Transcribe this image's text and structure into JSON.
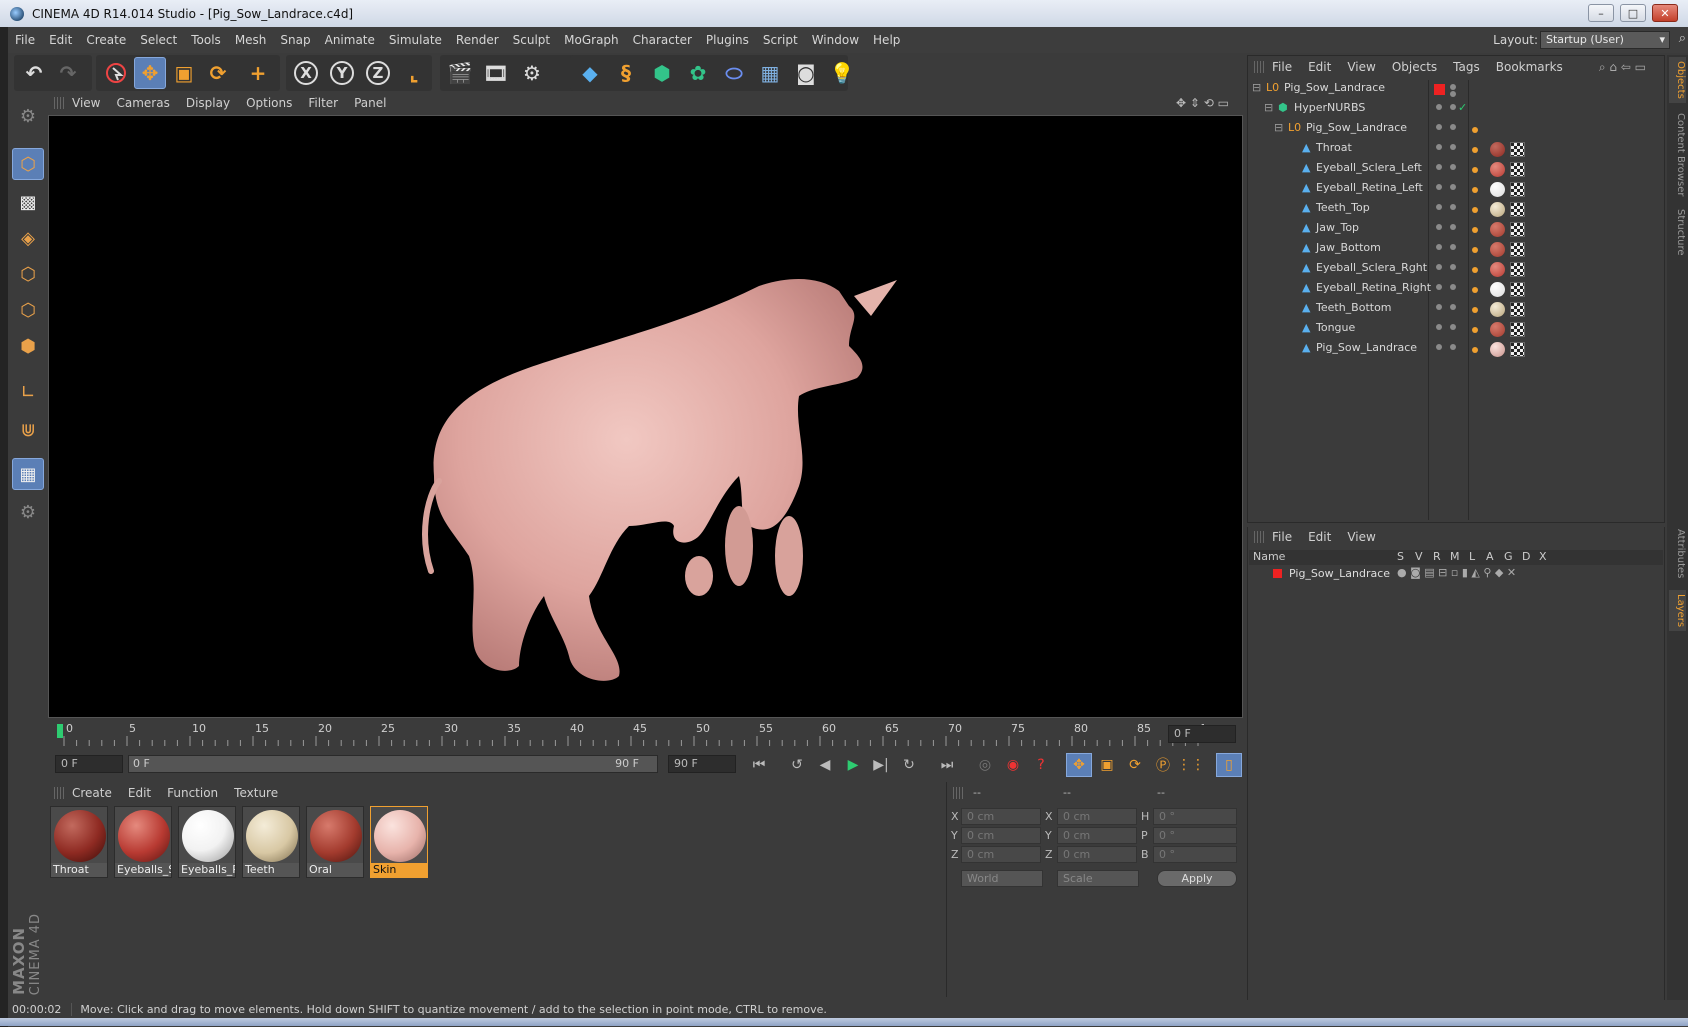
{
  "window": {
    "title": "CINEMA 4D R14.014 Studio - [Pig_Sow_Landrace.c4d]",
    "min": "–",
    "max": "□",
    "close": "✕"
  },
  "menubar": {
    "items": [
      "File",
      "Edit",
      "Create",
      "Select",
      "Tools",
      "Mesh",
      "Snap",
      "Animate",
      "Simulate",
      "Render",
      "Sculpt",
      "MoGraph",
      "Character",
      "Plugins",
      "Script",
      "Window",
      "Help"
    ],
    "layout_label": "Layout:",
    "layout_value": "Startup (User)"
  },
  "viewport": {
    "menu": [
      "View",
      "Cameras",
      "Display",
      "Options",
      "Filter",
      "Panel"
    ]
  },
  "timeline": {
    "ticks": [
      "0",
      "5",
      "10",
      "15",
      "20",
      "25",
      "30",
      "35",
      "40",
      "45",
      "50",
      "55",
      "60",
      "65",
      "70",
      "75",
      "80",
      "85",
      "90"
    ],
    "current_frame": "0 F",
    "start": "0 F",
    "range_start": "0 F",
    "range_end": "90 F",
    "end": "90 F"
  },
  "materials": {
    "menu": [
      "Create",
      "Edit",
      "Function",
      "Texture"
    ],
    "items": [
      {
        "name": "Throat",
        "color": "#8e2a22"
      },
      {
        "name": "Eyeballs_Sc",
        "color": "#b83a32"
      },
      {
        "name": "Eyeballs_Re",
        "color": "#f2f2f2"
      },
      {
        "name": "Teeth",
        "color": "#d8c8a4"
      },
      {
        "name": "Oral",
        "color": "#a33b2e"
      },
      {
        "name": "Skin",
        "color": "#e7b3ab"
      }
    ]
  },
  "coords": {
    "headers": [
      "--",
      "--",
      "--"
    ],
    "rows": [
      {
        "a": "X",
        "av": "0 cm",
        "b": "X",
        "bv": "0 cm",
        "c": "H",
        "cv": "0 °"
      },
      {
        "a": "Y",
        "av": "0 cm",
        "b": "Y",
        "bv": "0 cm",
        "c": "P",
        "cv": "0 °"
      },
      {
        "a": "Z",
        "av": "0 cm",
        "b": "Z",
        "bv": "0 cm",
        "c": "B",
        "cv": "0 °"
      }
    ],
    "world": "World",
    "scale": "Scale",
    "apply": "Apply"
  },
  "objects": {
    "menu": [
      "File",
      "Edit",
      "View",
      "Objects",
      "Tags",
      "Bookmarks"
    ],
    "tree": [
      "Pig_Sow_Landrace",
      "HyperNURBS",
      "Pig_Sow_Landrace",
      "Throat",
      "Eyeball_Sclera_Left",
      "Eyeball_Retina_Left",
      "Teeth_Top",
      "Jaw_Top",
      "Jaw_Bottom",
      "Eyeball_Sclera_Rght",
      "Eyeball_Retina_Right",
      "Teeth_Bottom",
      "Tongue",
      "Pig_Sow_Landrace"
    ]
  },
  "layers": {
    "menu": [
      "File",
      "Edit",
      "View"
    ],
    "columns": [
      "Name",
      "S",
      "V",
      "R",
      "M",
      "L",
      "A",
      "G",
      "D",
      "X"
    ],
    "rows": [
      "Pig_Sow_Landrace"
    ]
  },
  "right_tabs": [
    "Objects",
    "Content Browser",
    "Structure",
    "Attributes",
    "Layers"
  ],
  "brand": {
    "line1": "MAXON",
    "line2": "CINEMA 4D"
  },
  "status": {
    "time": "00:00:02",
    "message": "Move: Click and drag to move elements. Hold down SHIFT to quantize movement / add to the selection in point mode, CTRL to remove."
  }
}
